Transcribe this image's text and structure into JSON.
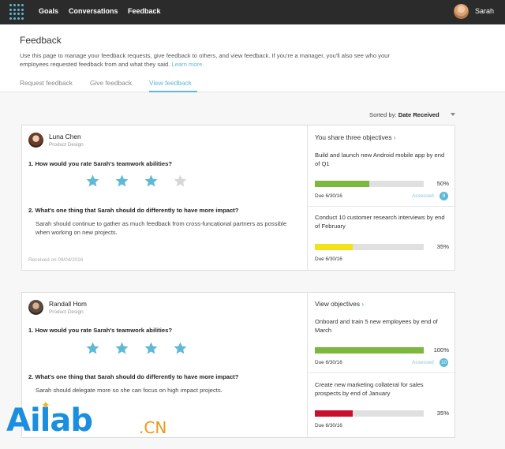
{
  "nav": {
    "items": [
      "Goals",
      "Conversations",
      "Feedback"
    ],
    "user_name": "Sarah"
  },
  "page": {
    "title": "Feedback",
    "description": "Use this page to manage your feedback requests, give feedback to others, and view feedback. If you're a manager, you'll also see who your employees requested feedback from and what they said.",
    "learn_more": "Learn more.",
    "tabs": [
      "Request feedback",
      "Give feedback",
      "View feedback"
    ],
    "active_tab": "View feedback"
  },
  "sort": {
    "label": "Sorted by:",
    "value": "Date Received"
  },
  "cards": [
    {
      "name": "Luna Chen",
      "role": "Product Design",
      "q1": "1.  How would you rate Sarah's teamwork abilities?",
      "rating": 3,
      "rating_max": 4,
      "q2": "2.  What's one thing that Sarah should do differently to have more impact?",
      "answer": "Sarah should continue to gather as much feedback from cross-funcational partners as possible when working on new projects.",
      "received": "Received on 09/04/2016",
      "objectives_header": "You share three objectives",
      "objectives": [
        {
          "title": "Build and launch new Android mobile app by end of Q1",
          "progress": 0.5,
          "pct": "50%",
          "due": "Due 6/30/16",
          "assessed": "Assessed",
          "badge": "8",
          "color": "#7cb83e"
        },
        {
          "title": "Conduct 10 customer research interviews by end of February",
          "progress": 0.35,
          "pct": "35%",
          "due": "Due 6/30/16",
          "color": "#f2e21a"
        }
      ]
    },
    {
      "name": "Randall Hom",
      "role": "Product Design",
      "q1": "1.  How would you rate Sarah's teamwork abilities?",
      "rating": 4,
      "rating_max": 4,
      "q2": "2.  What's one thing that Sarah should do differently to have more impact?",
      "answer": "Sarah should delegate more so she can focus on high impact projects.",
      "objectives_header": "View objectives",
      "objectives": [
        {
          "title": "Onboard and train 5 new employees by end of March",
          "progress": 1.0,
          "pct": "100%",
          "due": "Due 6/30/16",
          "assessed": "Assessed",
          "badge": "10",
          "color": "#7cb83e"
        },
        {
          "title": "Create new marketing collateral for sales prospects by end of January",
          "progress": 0.35,
          "pct": "35%",
          "due": "Due 6/30/16",
          "color": "#c8102e"
        }
      ]
    }
  ],
  "watermark": {
    "text": "Ailab",
    "suffix": ".CN"
  },
  "colors": {
    "accent": "#5fb8d6",
    "topbar": "#2b2b2b"
  }
}
